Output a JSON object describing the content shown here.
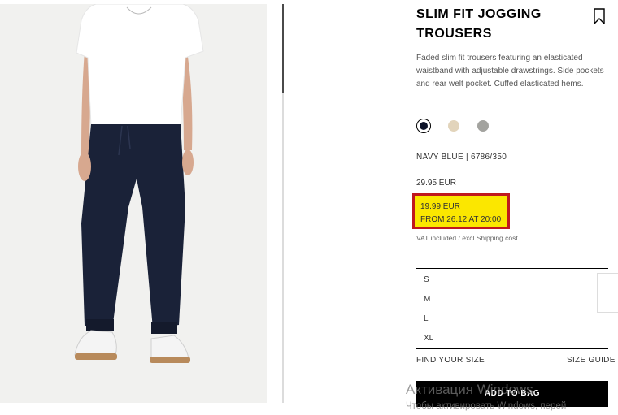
{
  "product": {
    "title": "SLIM FIT JOGGING TROUSERS",
    "description": "Faded slim fit trousers featuring an elasticated waistband with adjustable drawstrings. Side pockets and rear welt pocket. Cuffed elasticated hems.",
    "colors": [
      {
        "name": "navy",
        "hex": "#0c1228",
        "selected": true
      },
      {
        "name": "beige",
        "hex": "#e2d4bb",
        "selected": false
      },
      {
        "name": "grey",
        "hex": "#a3a39f",
        "selected": false
      }
    ],
    "color_reference": "NAVY BLUE | 6786/350",
    "old_price": "29.95 EUR",
    "promo_price": "19.99 EUR",
    "promo_date": "FROM 26.12 AT 20:00",
    "vat_note": "VAT included / excl Shipping cost",
    "sizes": [
      "S",
      "M",
      "L",
      "XL"
    ],
    "find_your_size": "FIND YOUR SIZE",
    "size_guide": "SIZE GUIDE",
    "add_to_bag": "ADD TO BAG"
  },
  "watermark": {
    "line1": "Активация Windows",
    "line2": "Чтобы активировать Windows, перей"
  },
  "colors": {
    "promo_bg": "#fbe700",
    "promo_border": "#c0181e"
  }
}
